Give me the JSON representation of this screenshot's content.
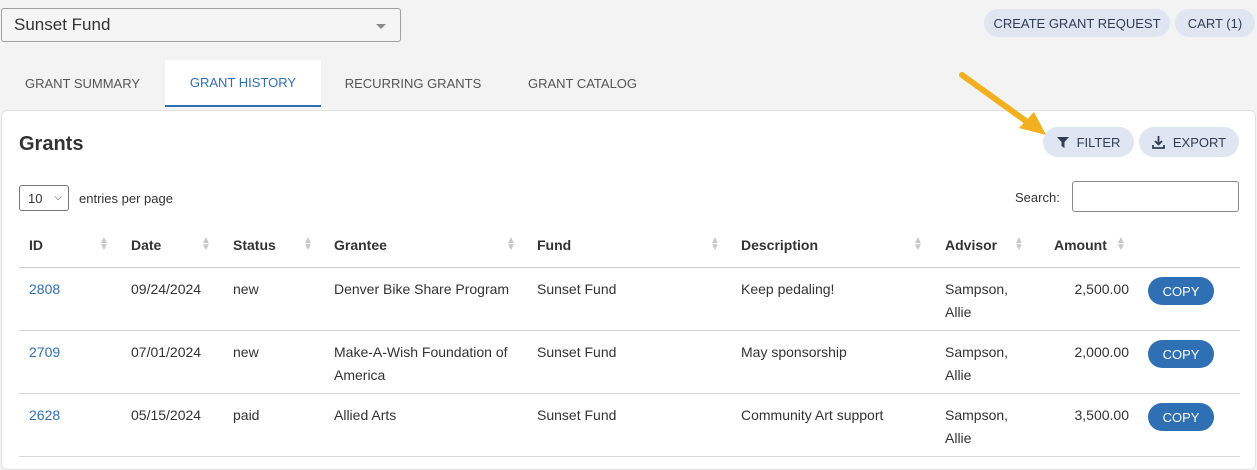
{
  "fund_select": {
    "value": "Sunset Fund"
  },
  "top_actions": {
    "create_grant_request": "CREATE GRANT REQUEST",
    "cart": "CART (1)"
  },
  "tabs": [
    {
      "label": "GRANT SUMMARY",
      "active": false
    },
    {
      "label": "GRANT HISTORY",
      "active": true
    },
    {
      "label": "RECURRING GRANTS",
      "active": false
    },
    {
      "label": "GRANT CATALOG",
      "active": false
    }
  ],
  "card": {
    "title": "Grants",
    "filter_label": "FILTER",
    "export_label": "EXPORT",
    "entries_value": "10",
    "entries_label": "entries per page",
    "search_label": "Search:",
    "search_value": ""
  },
  "table": {
    "headers": [
      "ID",
      "Date",
      "Status",
      "Grantee",
      "Fund",
      "Description",
      "Advisor",
      "Amount"
    ],
    "rows": [
      {
        "id": "2808",
        "date": "09/24/2024",
        "status": "new",
        "grantee_l1": "Denver Bike Share Program",
        "grantee_l2": "",
        "fund": "Sunset Fund",
        "description": "Keep pedaling!",
        "advisor_l1": "Sampson,",
        "advisor_l2": "Allie",
        "amount": "2,500.00",
        "action": "COPY"
      },
      {
        "id": "2709",
        "date": "07/01/2024",
        "status": "new",
        "grantee_l1": "Make-A-Wish Foundation of",
        "grantee_l2": "America",
        "fund": "Sunset Fund",
        "description": "May sponsorship",
        "advisor_l1": "Sampson,",
        "advisor_l2": "Allie",
        "amount": "2,000.00",
        "action": "COPY"
      },
      {
        "id": "2628",
        "date": "05/15/2024",
        "status": "paid",
        "grantee_l1": "Allied Arts",
        "grantee_l2": "",
        "fund": "Sunset Fund",
        "description": "Community Art support",
        "advisor_l1": "Sampson,",
        "advisor_l2": "Allie",
        "amount": "3,500.00",
        "action": "COPY"
      }
    ]
  },
  "colors": {
    "accent": "#2f6fb3",
    "pill_bg": "#dfe6f1",
    "annotation_arrow": "#f2b01e"
  }
}
